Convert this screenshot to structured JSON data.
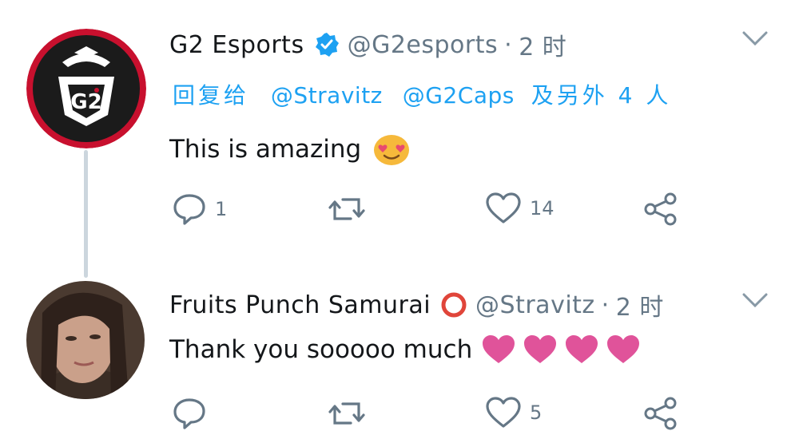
{
  "tweets": [
    {
      "name": "G2 Esports",
      "handle": "@G2esports",
      "dot": "·",
      "time": "2 时",
      "reply_label": "回复给",
      "reply_mentions": [
        "@Stravitz",
        "@G2Caps"
      ],
      "reply_suffix": "及另外 4 人",
      "text": "This is amazing",
      "emoji": "heart-eyes-emoji",
      "counts": {
        "reply": "1",
        "retweet": "",
        "like": "14"
      },
      "verified": true
    },
    {
      "name": "Fruits Punch Samurai",
      "handle": "@Stravitz",
      "dot": "·",
      "time": "2 时",
      "text": "Thank you sooooo much",
      "emoji": "pink-hearts-emoji",
      "counts": {
        "reply": "",
        "retweet": "",
        "like": "5"
      }
    }
  ],
  "colors": {
    "link": "#1da1f2",
    "muted": "#657786",
    "verified": "#1da1f2",
    "g2_ring": "#c8102e",
    "heart": "#e0539a",
    "thread_line": "#ccd6dd"
  }
}
